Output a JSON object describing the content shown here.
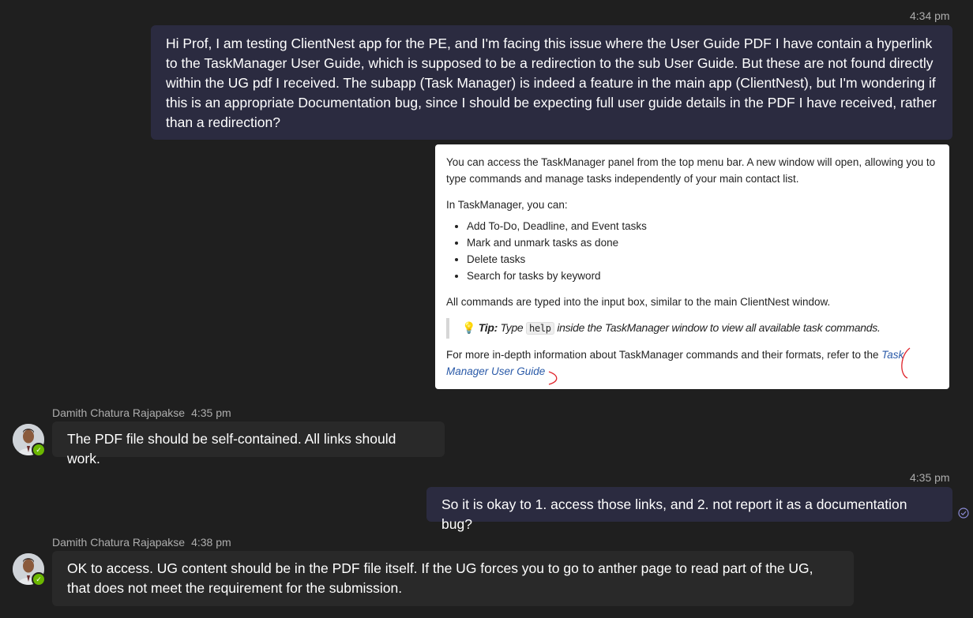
{
  "messages": [
    {
      "time": "4:34 pm",
      "text": "Hi Prof, I am testing ClientNest app for the PE, and I'm facing this issue where the User Guide PDF I have contain a hyperlink to the TaskManager User Guide, which is supposed to be a redirection to the sub User Guide. But these are not found directly within the UG pdf I received. The subapp (Task Manager) is indeed a feature in the main app (ClientNest), but I'm wondering if this is an appropriate Documentation bug, since I should be expecting full user guide details in the PDF I have received, rather than a redirection?"
    },
    {
      "sender": "Damith Chatura Rajapakse",
      "time": "4:35 pm",
      "text": "The PDF file should be self-contained. All links should work."
    },
    {
      "time": "4:35 pm",
      "text": "So it is okay to 1. access those links, and 2. not report it as a documentation bug?"
    },
    {
      "sender": "Damith Chatura Rajapakse",
      "time": "4:38 pm",
      "text": "OK to access. UG content should be in the PDF file itself. If the UG forces you to go to anther page to read part of the UG, that does not meet the requirement for the submission."
    }
  ],
  "screenshot": {
    "intro": "You can access the TaskManager panel from the top menu bar. A new window will open, allowing you to type commands and manage tasks independently of your main contact list.",
    "lead": "In TaskManager, you can:",
    "bullets": [
      "Add To-Do, Deadline, and Event tasks",
      "Mark and unmark tasks as done",
      "Delete tasks",
      "Search for tasks by keyword"
    ],
    "commands": "All commands are typed into the input box, similar to the main ClientNest window.",
    "tip_label": "Tip:",
    "tip_before": "Type",
    "tip_code": "help",
    "tip_after": "inside the TaskManager window to view all available task commands.",
    "footer": "For more in-depth information about TaskManager commands and their formats, refer to the",
    "link": "Task Manager User Guide"
  },
  "colors": {
    "background": "#1f1f1f",
    "my_bubble": "#2b2b40",
    "their_bubble": "#292929",
    "presence": "#6bb700",
    "annotation": "#e0242b"
  }
}
